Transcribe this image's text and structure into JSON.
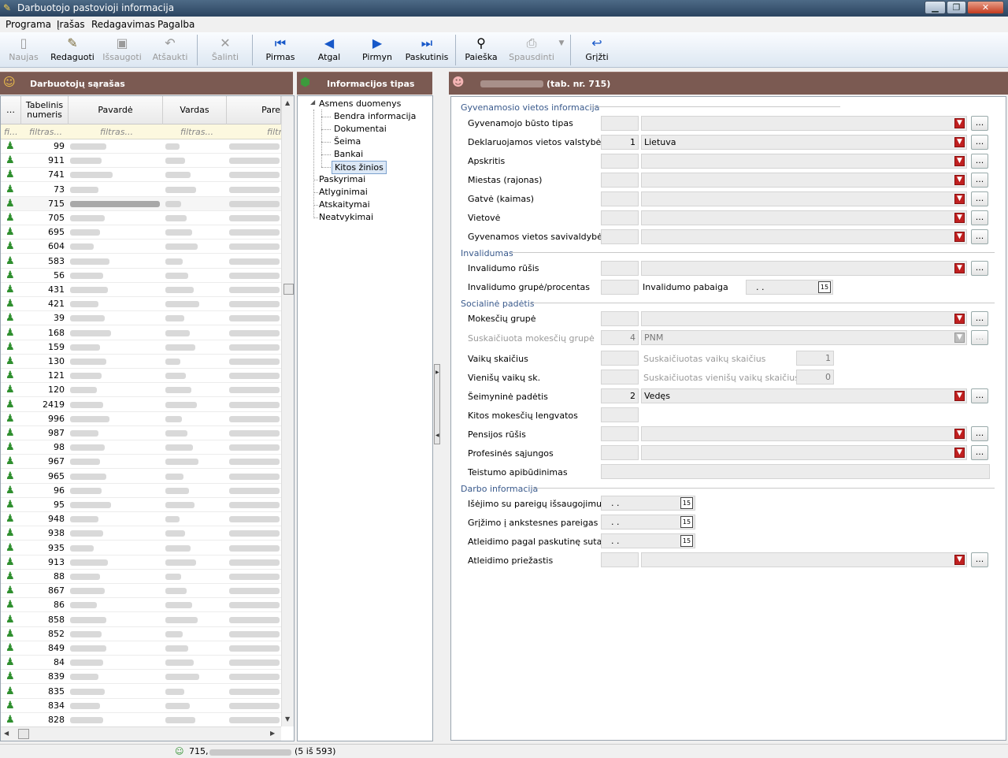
{
  "window": {
    "title": "Darbuotojo pastovioji informacija"
  },
  "menu": [
    "Programa",
    "Įrašas",
    "Redagavimas",
    "Pagalba"
  ],
  "toolbar": {
    "naujas": "Naujas",
    "redaguoti": "Redaguoti",
    "issaugoti": "Išsaugoti",
    "atsaukti": "Atšaukti",
    "salinti": "Šalinti",
    "pirmas": "Pirmas",
    "atgal": "Atgal",
    "pirmyn": "Pirmyn",
    "paskutinis": "Paskutinis",
    "paieska": "Paieška",
    "spausdinti": "Spausdinti",
    "grizti": "Grįžti"
  },
  "employees": {
    "title": "Darbuotojų sąrašas",
    "columns": [
      "…",
      "Tabelinis numeris",
      "Pavardė",
      "Vardas",
      "Pare"
    ],
    "filter_placeholder": [
      "fi...",
      "filtras...",
      "filtras...",
      "filtras...",
      "filtr"
    ],
    "numbers": [
      "99",
      "911",
      "741",
      "73",
      "715",
      "705",
      "695",
      "604",
      "583",
      "56",
      "431",
      "421",
      "39",
      "168",
      "159",
      "130",
      "121",
      "120",
      "2419",
      "996",
      "987",
      "98",
      "967",
      "965",
      "96",
      "95",
      "948",
      "938",
      "935",
      "913",
      "88",
      "867",
      "86",
      "858",
      "852",
      "849",
      "84",
      "839",
      "835",
      "834",
      "828"
    ],
    "selected_index": 4
  },
  "infotype": {
    "title": "Informacijos tipas",
    "root": "Asmens duomenys",
    "children": [
      "Bendra informacija",
      "Dokumentai",
      "Šeima",
      "Bankai",
      "Kitos žinios"
    ],
    "others": [
      "Paskyrimai",
      "Atlyginimai",
      "Atskaitymai",
      "Neatvykimai"
    ],
    "selected": "Kitos žinios"
  },
  "detail": {
    "title_suffix": "(tab. nr. 715)",
    "sections": {
      "gyv": "Gyvenamosio vietos informacija",
      "inv": "Invalidumas",
      "soc": "Socialinė padėtis",
      "darbo": "Darbo informacija"
    },
    "labels": {
      "busto_tipas": "Gyvenamojo būsto tipas",
      "dekl_valstybe": "Deklaruojamos vietos valstybė",
      "apskritis": "Apskritis",
      "miestas": "Miestas (rajonas)",
      "gatve": "Gatvė (kaimas)",
      "vietove": "Vietovė",
      "savivaldybe": "Gyvenamos vietos savivaldybė",
      "inv_rusis": "Invalidumo rūšis",
      "inv_grupe": "Invalidumo grupė/procentas",
      "inv_pabaiga": "Invalidumo pabaiga",
      "mok_grupe": "Mokesčių grupė",
      "susk_mok_grupe": "Suskaičiuota mokesčių grupė",
      "vaiku_sk": "Vaikų skaičius",
      "susk_vaiku_sk": "Suskaičiuotas vaikų skaičius",
      "vienisu_sk": "Vienišų vaikų sk.",
      "susk_vienisu_sk": "Suskaičiuotas vienišų vaikų skaičius",
      "seimynine": "Šeimyninė padėtis",
      "kitos_lengvatos": "Kitos mokesčių lengvatos",
      "pensijos": "Pensijos rūšis",
      "profsajungos": "Profesinės sąjungos",
      "teistumas": "Teistumo apibūdinimas",
      "isejimas": "Išėjimo su pareigų išsaugojimu data",
      "grizimas": "Grįžimo į ankstesnes pareigas data",
      "atleidimas_sut": "Atleidimo pagal paskutinę sutartį da",
      "atleidimo_priezastis": "Atleidimo priežastis"
    },
    "values": {
      "dekl_code": "1",
      "dekl_name": "Lietuva",
      "susk_mok_code": "4",
      "susk_mok_name": "PNM",
      "susk_vaiku": "1",
      "susk_vienisu": "0",
      "seim_code": "2",
      "seim_name": "Vedęs",
      "empty_date": ". ."
    }
  },
  "status": {
    "text": "715,",
    "count": "(5 iš 593)"
  }
}
